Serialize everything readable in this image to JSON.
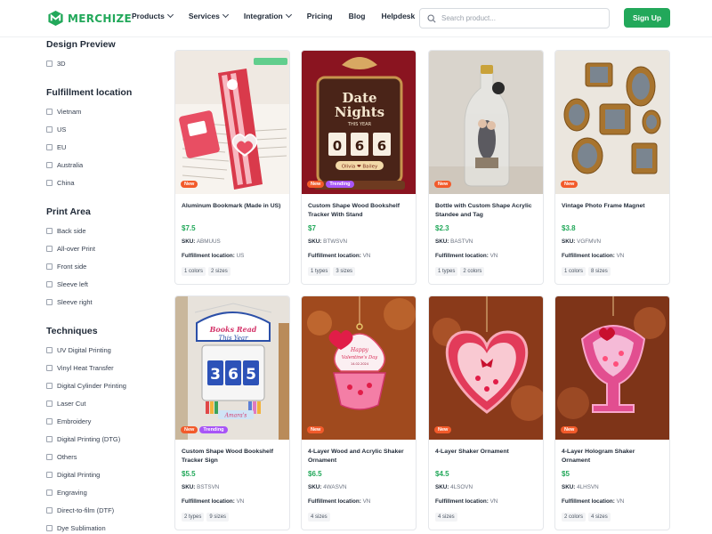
{
  "header": {
    "logo_text": "MERCHIZE",
    "nav": [
      {
        "label": "Products",
        "dropdown": true
      },
      {
        "label": "Services",
        "dropdown": true
      },
      {
        "label": "Integration",
        "dropdown": true
      },
      {
        "label": "Pricing",
        "dropdown": false
      },
      {
        "label": "Blog",
        "dropdown": false
      },
      {
        "label": "Helpdesk",
        "dropdown": false
      }
    ],
    "search_placeholder": "Search product...",
    "signup_label": "Sign Up"
  },
  "sidebar": {
    "design_preview": {
      "title": "Design Preview",
      "options": [
        "3D"
      ]
    },
    "fulfillment": {
      "title": "Fulfillment location",
      "options": [
        "Vietnam",
        "US",
        "EU",
        "Australia",
        "China"
      ]
    },
    "print_area": {
      "title": "Print Area",
      "options": [
        "Back side",
        "All-over Print",
        "Front side",
        "Sleeve left",
        "Sleeve right"
      ]
    },
    "techniques": {
      "title": "Techniques",
      "options": [
        "UV Digital Printing",
        "Vinyl Heat Transfer",
        "Digital Cylinder Printing",
        "Laser Cut",
        "Embroidery",
        "Digital Printing (DTG)",
        "Others",
        "Digital Printing",
        "Engraving",
        "Direct-to-film (DTF)",
        "Dye Sublimation"
      ]
    }
  },
  "labels": {
    "sku": "SKU:",
    "fulfillment": "Fulfillment location:"
  },
  "products": [
    {
      "title": "Aluminum Bookmark (Made in US)",
      "price": "$7.5",
      "sku": "ABMUUS",
      "location": "US",
      "badges": [
        "New"
      ],
      "tags": [
        "1 colors",
        "2 sizes"
      ]
    },
    {
      "title": "Custom Shape Wood Bookshelf Tracker With Stand",
      "price": "$7",
      "sku": "BTWSVN",
      "location": "VN",
      "badges": [
        "New",
        "Trending"
      ],
      "tags": [
        "1 types",
        "3 sizes"
      ],
      "image_text": {
        "line1": "Date",
        "line2": "Nights",
        "sub": "THIS YEAR",
        "digits": [
          "0",
          "6",
          "6"
        ],
        "names": "Olivia ❤ Bailey"
      }
    },
    {
      "title": "Bottle with Custom Shape Acrylic Standee and Tag",
      "price": "$2.3",
      "sku": "BASTVN",
      "location": "VN",
      "badges": [
        "New"
      ],
      "tags": [
        "1 types",
        "2 colors"
      ]
    },
    {
      "title": "Vintage Photo Frame Magnet",
      "price": "$3.8",
      "sku": "VGFMVN",
      "location": "VN",
      "badges": [
        "New"
      ],
      "tags": [
        "1 colors",
        "8 sizes"
      ]
    },
    {
      "title": "Custom Shape Wood Bookshelf Tracker Sign",
      "price": "$5.5",
      "sku": "BSTSVN",
      "location": "VN",
      "badges": [
        "New",
        "Trending"
      ],
      "tags": [
        "2 types",
        "9 sizes"
      ],
      "image_text": {
        "line1": "Books Read",
        "line2": "This Year",
        "digits": [
          "3",
          "6",
          "5"
        ],
        "name": "Amara's"
      }
    },
    {
      "title": "4-Layer Wood and Acrylic Shaker Ornament",
      "price": "$6.5",
      "sku": "4WASVN",
      "location": "VN",
      "badges": [
        "New"
      ],
      "tags": [
        "4 sizes"
      ],
      "image_text": {
        "line1": "Happy",
        "line2": "Valentine's Day",
        "date": "14.02.2024"
      }
    },
    {
      "title": "4-Layer Shaker Ornament",
      "price": "$4.5",
      "sku": "4LSOVN",
      "location": "VN",
      "badges": [
        "New"
      ],
      "tags": [
        "4 sizes"
      ]
    },
    {
      "title": "4-Layer Hologram Shaker Ornament",
      "price": "$5",
      "sku": "4LHSVN",
      "location": "VN",
      "badges": [
        "New"
      ],
      "tags": [
        "2 colors",
        "4 sizes"
      ]
    }
  ],
  "colors": {
    "brand": "#22a85a",
    "new_badge": "#f25a2a",
    "trending_badge": "#a855f7"
  }
}
